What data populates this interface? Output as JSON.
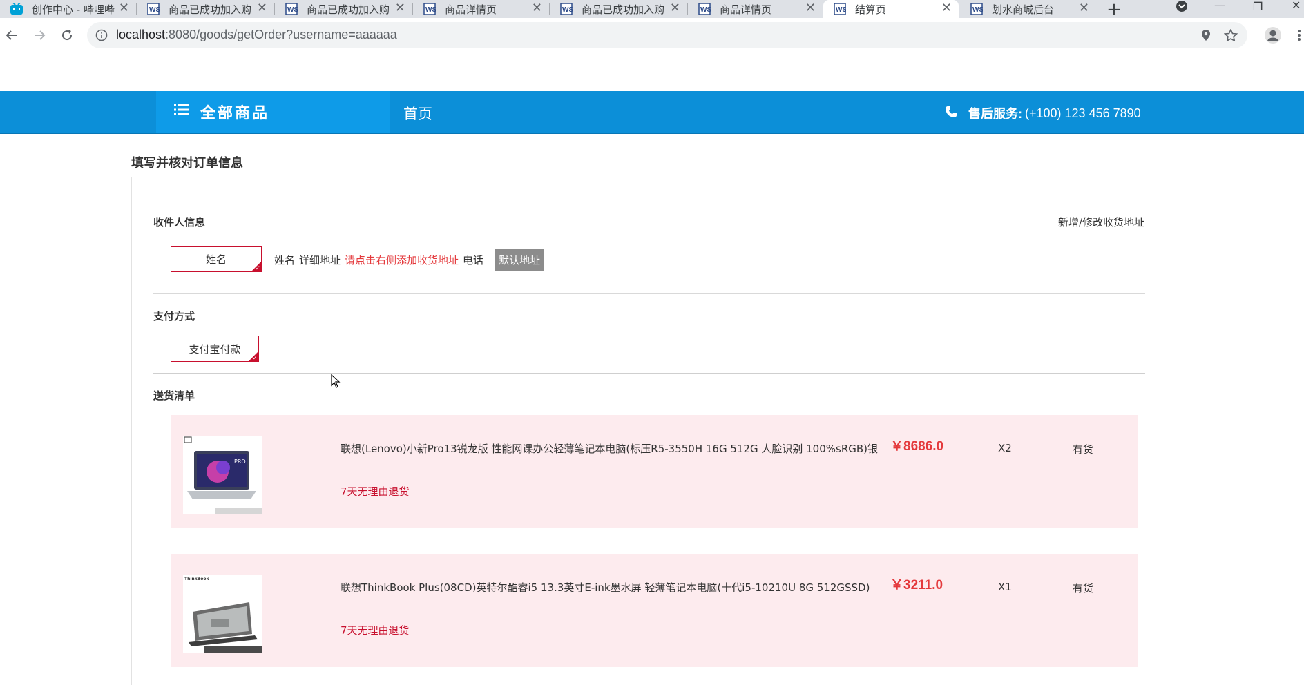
{
  "browser": {
    "tabs": [
      {
        "title": "创作中心 - 哔哩哔",
        "icon": "bilibili-icon",
        "active": false
      },
      {
        "title": "商品已成功加入购",
        "icon": "webstorm-icon",
        "active": false
      },
      {
        "title": "商品已成功加入购",
        "icon": "webstorm-icon",
        "active": false
      },
      {
        "title": "商品详情页",
        "icon": "webstorm-icon",
        "active": false
      },
      {
        "title": "商品已成功加入购",
        "icon": "webstorm-icon",
        "active": false
      },
      {
        "title": "商品详情页",
        "icon": "webstorm-icon",
        "active": false
      },
      {
        "title": "结算页",
        "icon": "webstorm-icon",
        "active": true
      },
      {
        "title": "划水商城后台",
        "icon": "webstorm-icon",
        "active": false
      }
    ],
    "url_host": "localhost",
    "url_rest": ":8080/goods/getOrder?username=aaaaaa"
  },
  "header": {
    "all_goods": "全部商品",
    "home": "首页",
    "service_label": "售后服务:",
    "service_phone": "(+100) 123 456 7890"
  },
  "page": {
    "title": "填写并核对订单信息",
    "receiver": {
      "label": "收件人信息",
      "edit_link": "新增/修改收货地址",
      "selected": "姓名",
      "name": "姓名",
      "address_label": "详细地址",
      "address_hint": "请点击右侧添加收货地址",
      "phone_label": "电话",
      "default_badge": "默认地址"
    },
    "payment": {
      "label": "支付方式",
      "selected": "支付宝付款"
    },
    "delivery": {
      "label": "送货清单",
      "items": [
        {
          "name": "联想(Lenovo)小新Pro13锐龙版 性能网课办公轻薄笔记本电脑(标压R5-3550H 16G 512G 人脸识别 100%sRGB)银",
          "return_policy": "7天无理由退货",
          "price": "￥8686.0",
          "qty": "X2",
          "stock": "有货"
        },
        {
          "name": "联想ThinkBook Plus(08CD)英特尔酷睿i5 13.3英寸E-ink墨水屏 轻薄笔记本电脑(十代i5-10210U 8G 512GSSD)",
          "return_policy": "7天无理由退货",
          "price": "￥3211.0",
          "qty": "X1",
          "stock": "有货"
        }
      ]
    }
  },
  "colors": {
    "brand_blue": "#0c8fd8",
    "accent_red": "#c8102e",
    "price_red": "#e4393c",
    "item_bg": "#fdebee"
  }
}
